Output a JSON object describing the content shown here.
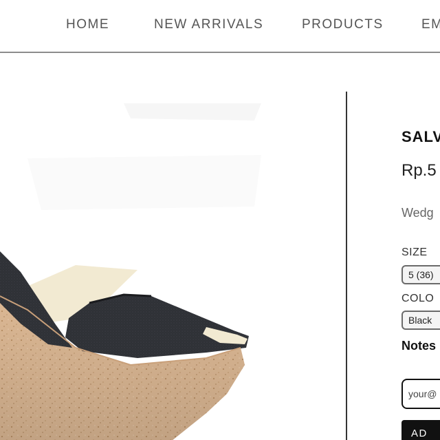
{
  "nav": {
    "items": [
      "HOME",
      "NEW ARRIVALS",
      "PRODUCTS",
      "EM"
    ]
  },
  "product": {
    "title": "SALV",
    "price": "Rp.5",
    "description": "Wedg",
    "size_label": "SIZE",
    "size_value": "5 (36)",
    "color_label": "COLO",
    "color_value": "Black",
    "notes_label": "Notes",
    "email_value": "your@",
    "add_button_label": "AD"
  },
  "colors": {
    "shoe_upper": "#2b2d31",
    "cork": "#d9b48f",
    "nav_text": "#555555",
    "button_bg": "#111111"
  }
}
